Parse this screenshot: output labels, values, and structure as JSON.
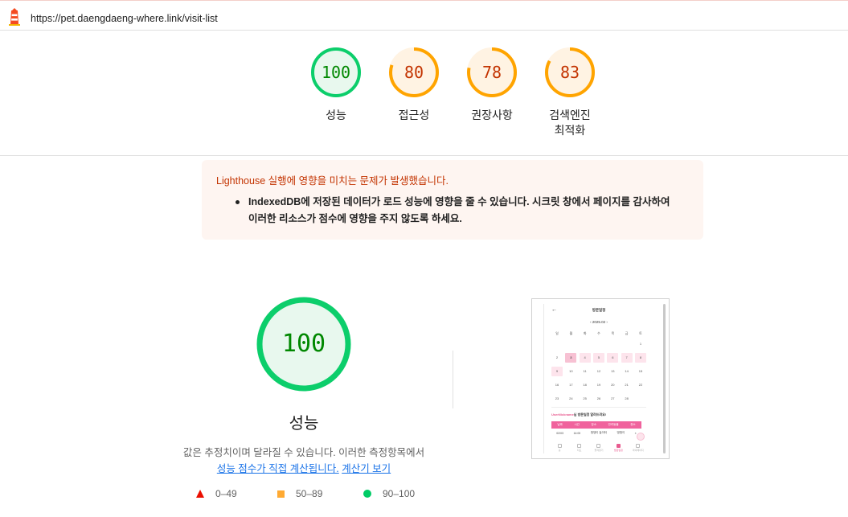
{
  "url_bar": {
    "url": "https://pet.daengdaeng-where.link/visit-list",
    "icon": "lighthouse-icon"
  },
  "scores": [
    {
      "label": "성능",
      "value": "100",
      "score": 100,
      "color": "#0cce6b",
      "text_color": "#008800",
      "fill": "#e8f8ee"
    },
    {
      "label": "접근성",
      "value": "80",
      "score": 80,
      "color": "#ffa400",
      "text_color": "#c33300",
      "fill": "#fff3e3"
    },
    {
      "label": "권장사항",
      "value": "78",
      "score": 78,
      "color": "#ffa400",
      "text_color": "#c33300",
      "fill": "#fff3e3"
    },
    {
      "label": "검색엔진",
      "label2": "최적화",
      "value": "83",
      "score": 83,
      "color": "#ffa400",
      "text_color": "#c33300",
      "fill": "#fff3e3"
    }
  ],
  "warning": {
    "title": "Lighthouse 실행에 영향을 미치는 문제가 발생했습니다.",
    "item_line1": "IndexedDB에 저장된 데이터가 로드 성능에 영향을 줄 수 있습니다. 시크릿 창에서 페이지를 감사하여",
    "item_line2": "이러한 리소스가 점수에 영향을 주지 않도록 하세요."
  },
  "performance": {
    "value": "100",
    "score": 100,
    "title": "성능",
    "description": "값은 추정치이며 달라질 수 있습니다. 이러한 측정항목에서",
    "link1": "성능 점수가 직접 계산됩니다.",
    "link2": "계산기 보기"
  },
  "legend": [
    {
      "range": "0–49",
      "shape": "triangle",
      "color": "#eb0f00"
    },
    {
      "range": "50–89",
      "shape": "square",
      "color": "#ffaa33"
    },
    {
      "range": "90–100",
      "shape": "circle",
      "color": "#00cc66"
    }
  ],
  "phone": {
    "back": "←",
    "title": "방문일정",
    "month": "‹  2025.02  ›",
    "weekdays": [
      "일",
      "월",
      "화",
      "수",
      "목",
      "금",
      "토"
    ],
    "weeks": [
      [
        "",
        "",
        "",
        "",
        "",
        "",
        "1"
      ],
      [
        "2",
        "3",
        "4",
        "5",
        "6",
        "7",
        "8"
      ],
      [
        "9",
        "10",
        "11",
        "12",
        "13",
        "14",
        "15"
      ],
      [
        "16",
        "17",
        "18",
        "19",
        "20",
        "21",
        "22"
      ],
      [
        "23",
        "24",
        "25",
        "26",
        "27",
        "28",
        ""
      ]
    ],
    "heading_name": "UserNickname",
    "heading_rest": "님 방문일정 알려드려요!",
    "table_headers": [
      "날짜",
      "시간",
      "장소",
      "반려동물",
      "취소"
    ],
    "table_row": [
      "02/03",
      "14:00",
      "댕댕이 놀이터",
      "댕댕이",
      "×"
    ],
    "nav": [
      "홈",
      "지도",
      "즐겨찾기",
      "방문일정",
      "마이페이지"
    ]
  }
}
